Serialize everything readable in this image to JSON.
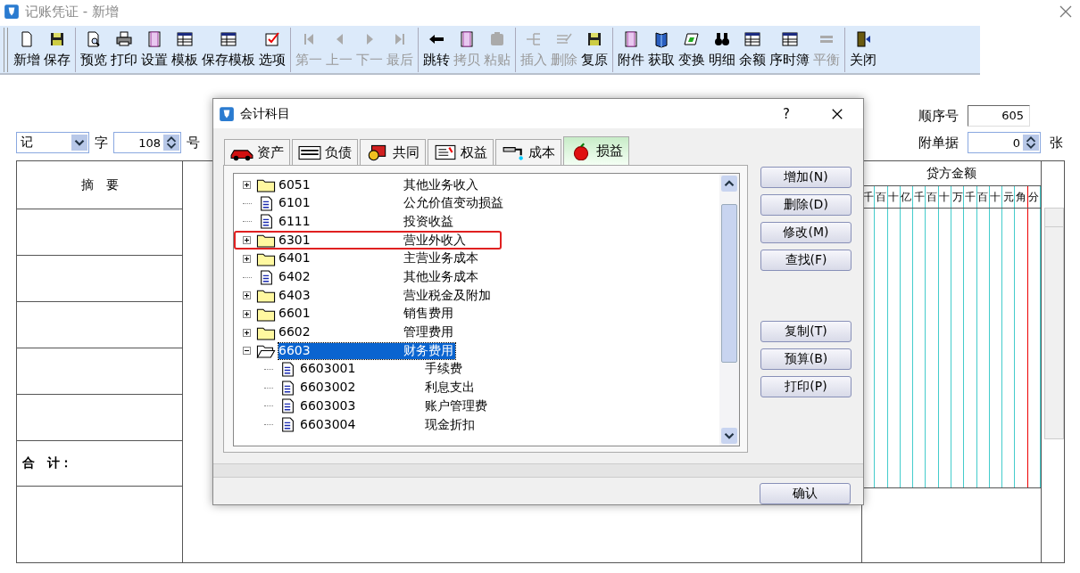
{
  "window": {
    "title": "记账凭证 - 新增"
  },
  "toolbar": {
    "groups": [
      [
        {
          "label": "新增",
          "disabled": false
        },
        {
          "label": "保存",
          "disabled": false
        }
      ],
      [
        {
          "label": "预览",
          "disabled": false
        },
        {
          "label": "打印",
          "disabled": false
        },
        {
          "label": "设置",
          "disabled": false
        },
        {
          "label": "模板",
          "disabled": false
        },
        {
          "label": "保存模板",
          "disabled": false
        },
        {
          "label": "选项",
          "disabled": false
        }
      ],
      [
        {
          "label": "第一",
          "disabled": true
        },
        {
          "label": "上一",
          "disabled": true
        },
        {
          "label": "下一",
          "disabled": true
        },
        {
          "label": "最后",
          "disabled": true
        }
      ],
      [
        {
          "label": "跳转",
          "disabled": false
        },
        {
          "label": "拷贝",
          "disabled": true
        },
        {
          "label": "粘贴",
          "disabled": true
        }
      ],
      [
        {
          "label": "插入",
          "disabled": true
        },
        {
          "label": "删除",
          "disabled": true
        },
        {
          "label": "复原",
          "disabled": false
        }
      ],
      [
        {
          "label": "附件",
          "disabled": false
        },
        {
          "label": "获取",
          "disabled": false
        },
        {
          "label": "变换",
          "disabled": false
        },
        {
          "label": "明细",
          "disabled": false
        },
        {
          "label": "余额",
          "disabled": false
        },
        {
          "label": "序时簿",
          "disabled": false
        },
        {
          "label": "平衡",
          "disabled": true
        }
      ],
      [
        {
          "label": "关闭",
          "disabled": false
        }
      ]
    ]
  },
  "voucher": {
    "type_value": "记",
    "type_suffix": "字",
    "number_value": "108",
    "number_suffix": "号",
    "sequence_label": "顺序号",
    "sequence_value": "605",
    "attachments_label": "附单据",
    "attachments_value": "0",
    "attachments_suffix": "张",
    "summary_header": "摘　要",
    "credit_header": "贷方金额",
    "credit_digits": [
      "千",
      "百",
      "十",
      "亿",
      "千",
      "百",
      "十",
      "万",
      "千",
      "百",
      "十",
      "元",
      "角",
      "分"
    ],
    "total_label": "合　计："
  },
  "dialog": {
    "title": "会计科目",
    "help": "?",
    "tabs": [
      {
        "label": "资产",
        "selected": false
      },
      {
        "label": "负债",
        "selected": false
      },
      {
        "label": "共同",
        "selected": false
      },
      {
        "label": "权益",
        "selected": false
      },
      {
        "label": "成本",
        "selected": false
      },
      {
        "label": "损益",
        "selected": true
      }
    ],
    "tree": [
      {
        "kind": "folder",
        "code": "6051",
        "name": "其他业务收入",
        "expanded": false,
        "selected": false,
        "outlined": false
      },
      {
        "kind": "leaf",
        "code": "6101",
        "name": "公允价值变动损益",
        "selected": false,
        "outlined": false
      },
      {
        "kind": "leaf",
        "code": "6111",
        "name": "投资收益",
        "selected": false,
        "outlined": false
      },
      {
        "kind": "folder",
        "code": "6301",
        "name": "营业外收入",
        "expanded": false,
        "selected": false,
        "outlined": true
      },
      {
        "kind": "folder",
        "code": "6401",
        "name": "主营业务成本",
        "expanded": false,
        "selected": false,
        "outlined": false
      },
      {
        "kind": "leaf",
        "code": "6402",
        "name": "其他业务成本",
        "selected": false,
        "outlined": false
      },
      {
        "kind": "folder",
        "code": "6403",
        "name": "营业税金及附加",
        "expanded": false,
        "selected": false,
        "outlined": false
      },
      {
        "kind": "folder",
        "code": "6601",
        "name": "销售费用",
        "expanded": false,
        "selected": false,
        "outlined": false
      },
      {
        "kind": "folder",
        "code": "6602",
        "name": "管理费用",
        "expanded": false,
        "selected": false,
        "outlined": false
      },
      {
        "kind": "folder",
        "code": "6603",
        "name": "财务费用",
        "expanded": true,
        "selected": true,
        "outlined": false,
        "children": [
          {
            "kind": "leaf",
            "code": "6603001",
            "name": "手续费",
            "selected": false,
            "outlined": false
          },
          {
            "kind": "leaf",
            "code": "6603002",
            "name": "利息支出",
            "selected": false,
            "outlined": false
          },
          {
            "kind": "leaf",
            "code": "6603003",
            "name": "账户管理费",
            "selected": false,
            "outlined": false
          },
          {
            "kind": "leaf",
            "code": "6603004",
            "name": "现金折扣",
            "selected": false,
            "outlined": false
          }
        ]
      }
    ],
    "buttons": [
      [
        "增加(N)",
        "删除(D)",
        "修改(M)",
        "查找(F)"
      ],
      [
        "复制(T)",
        "预算(B)",
        "打印(P)"
      ]
    ],
    "confirm": "确认"
  }
}
